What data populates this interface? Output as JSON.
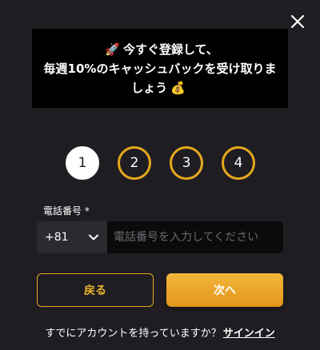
{
  "promo": {
    "line1_emoji": "🚀",
    "line1": "今すぐ登録して、",
    "line2": "毎週10%のキャッシュバックを受け取りま",
    "line3": "しょう",
    "line3_emoji": "💰"
  },
  "steps": [
    {
      "label": "1",
      "state": "active"
    },
    {
      "label": "2",
      "state": "pending"
    },
    {
      "label": "3",
      "state": "pending"
    },
    {
      "label": "4",
      "state": "pending"
    }
  ],
  "phone": {
    "label": "電話番号 *",
    "country_code": "+81",
    "placeholder": "電話番号を入力してください",
    "value": ""
  },
  "buttons": {
    "back": "戻る",
    "next": "次へ"
  },
  "footer": {
    "prompt": "すでにアカウントを持っていますか？",
    "signin": "サインイン"
  },
  "colors": {
    "background": "#1f1d22",
    "accent": "#e6a91e",
    "banner": "#000000"
  },
  "icons": {
    "close": "close-icon",
    "dropdown": "chevron-down-icon"
  }
}
